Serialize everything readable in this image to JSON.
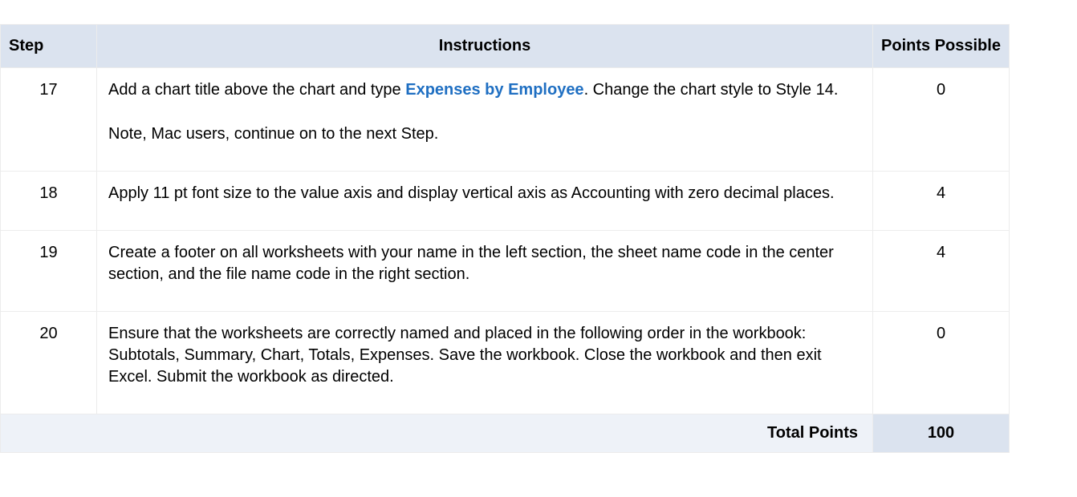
{
  "headers": {
    "step": "Step",
    "instructions": "Instructions",
    "points": "Points Possible"
  },
  "rows": [
    {
      "step": "17",
      "instr_a": "Add a chart title above the chart and type ",
      "instr_bold": "Expenses by Employee",
      "instr_b": ". Change the chart style to Style 14.",
      "note": "Note, Mac users, continue on to the next Step.",
      "points": "0"
    },
    {
      "step": "18",
      "instruction": "Apply 11 pt font size to the value axis and display vertical axis as Accounting with zero decimal places.",
      "points": "4"
    },
    {
      "step": "19",
      "instruction": "Create a footer on all worksheets with your name in the left section, the sheet name code in the center section, and the file name code in the right section.",
      "points": "4"
    },
    {
      "step": "20",
      "instruction": "Ensure that the worksheets are correctly named and placed in the following order in the workbook: Subtotals, Summary, Chart, Totals, Expenses. Save the workbook. Close the workbook and then exit Excel. Submit the workbook as directed.",
      "points": "0"
    }
  ],
  "total": {
    "label": "Total Points",
    "value": "100"
  }
}
